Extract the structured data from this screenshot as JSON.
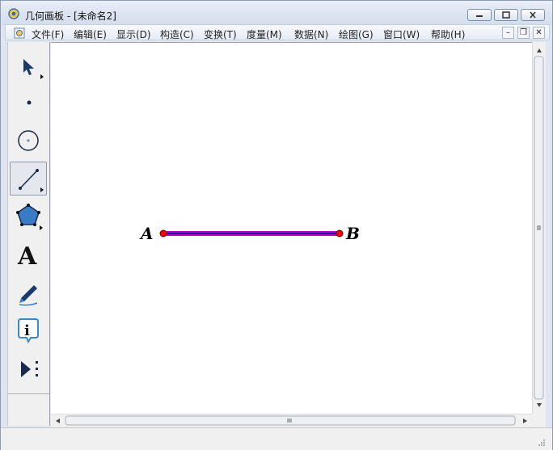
{
  "window": {
    "title": "几何画板 - [未命名2]"
  },
  "menu": {
    "items": [
      {
        "label": "文件(F)"
      },
      {
        "label": "编辑(E)"
      },
      {
        "label": "显示(D)"
      },
      {
        "label": "构造(C)"
      },
      {
        "label": "变换(T)"
      },
      {
        "label": "度量(M)"
      },
      {
        "label": "数据(N)"
      },
      {
        "label": "绘图(G)"
      },
      {
        "label": "窗口(W)"
      },
      {
        "label": "帮助(H)"
      }
    ]
  },
  "toolbox": {
    "tools": [
      {
        "name": "arrow-select-tool",
        "icon": "arrow-icon"
      },
      {
        "name": "point-tool",
        "icon": "point-icon"
      },
      {
        "name": "compass-tool",
        "icon": "circle-icon"
      },
      {
        "name": "straightedge-tool",
        "icon": "segment-icon",
        "selected": true
      },
      {
        "name": "polygon-tool",
        "icon": "pentagon-icon"
      },
      {
        "name": "text-tool",
        "icon": "text-a-icon",
        "glyph": "A"
      },
      {
        "name": "marker-tool",
        "icon": "marker-pen-icon"
      },
      {
        "name": "information-tool",
        "icon": "info-icon",
        "glyph": "i"
      },
      {
        "name": "custom-tool",
        "icon": "play-menu-icon"
      }
    ]
  },
  "canvas": {
    "points": [
      {
        "label": "A",
        "color": "#ff0000"
      },
      {
        "label": "B",
        "color": "#ff0000"
      }
    ],
    "segment": {
      "from": "A",
      "to": "B",
      "color": "#c000c0",
      "selected": true
    }
  },
  "colors": {
    "accent": "#4a78c0",
    "point": "#ff0000",
    "segment_highlight": "#c000c0"
  }
}
